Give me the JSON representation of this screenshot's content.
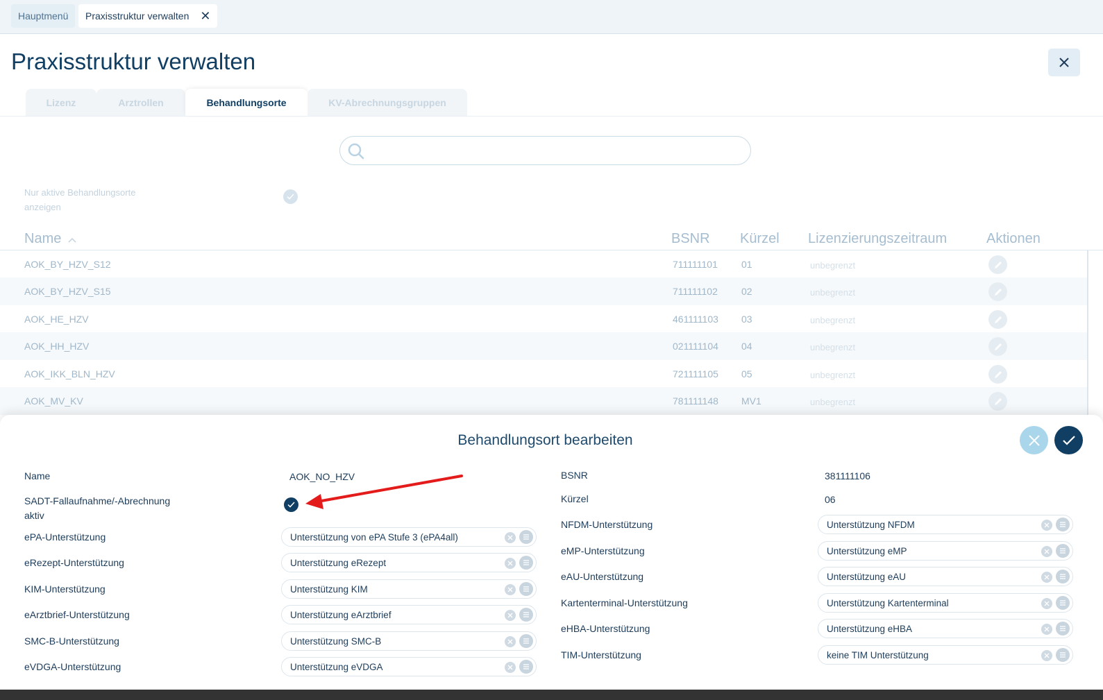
{
  "topbar": {
    "tab_home": "Hauptmenü",
    "tab_current": "Praxisstruktur verwalten",
    "tab_close": "✕"
  },
  "page": {
    "title": "Praxisstruktur verwalten"
  },
  "tabs": [
    {
      "label": "Lizenz",
      "active": false
    },
    {
      "label": "Arztrollen",
      "active": false
    },
    {
      "label": "Behandlungsorte",
      "active": true
    },
    {
      "label": "KV-Abrechnungsgruppen",
      "active": false
    }
  ],
  "search": {
    "placeholder": "",
    "value": ""
  },
  "filter": {
    "label": "Nur aktive Behandlungsorte anzeigen",
    "checked": true
  },
  "table": {
    "headers": {
      "name": "Name",
      "bsnr": "BSNR",
      "kuerzel": "Kürzel",
      "lizenz": "Lizenzierungszeitraum",
      "aktionen": "Aktionen"
    },
    "sort": "ascending",
    "rows": [
      {
        "name": "AOK_BY_HZV_S12",
        "bsnr": "711111101",
        "kuerzel": "01",
        "lizenz": "unbegrenzt"
      },
      {
        "name": "AOK_BY_HZV_S15",
        "bsnr": "711111102",
        "kuerzel": "02",
        "lizenz": "unbegrenzt"
      },
      {
        "name": "AOK_HE_HZV",
        "bsnr": "461111103",
        "kuerzel": "03",
        "lizenz": "unbegrenzt"
      },
      {
        "name": "AOK_HH_HZV",
        "bsnr": "021111104",
        "kuerzel": "04",
        "lizenz": "unbegrenzt"
      },
      {
        "name": "AOK_IKK_BLN_HZV",
        "bsnr": "721111105",
        "kuerzel": "05",
        "lizenz": "unbegrenzt"
      },
      {
        "name": "AOK_MV_KV",
        "bsnr": "781111148",
        "kuerzel": "MV1",
        "lizenz": "unbegrenzt"
      }
    ]
  },
  "editor": {
    "title": "Behandlungsort bearbeiten",
    "left": {
      "name_label": "Name",
      "name_value": "AOK_NO_HZV",
      "sadt_label": "SADT-Fallaufnahme/-Abrechnung aktiv",
      "sadt_checked": true,
      "selects": [
        {
          "label": "ePA-Unterstützung",
          "value": "Unterstützung von ePA Stufe 3 (ePA4all)"
        },
        {
          "label": "eRezept-Unterstützung",
          "value": "Unterstützung eRezept"
        },
        {
          "label": "KIM-Unterstützung",
          "value": "Unterstützung KIM"
        },
        {
          "label": "eArztbrief-Unterstützung",
          "value": "Unterstützung eArztbrief"
        },
        {
          "label": "SMC-B-Unterstützung",
          "value": "Unterstützung SMC-B"
        },
        {
          "label": "eVDGA-Unterstützung",
          "value": "Unterstützung eVDGA"
        }
      ]
    },
    "right": {
      "bsnr_label": "BSNR",
      "bsnr_value": "381111106",
      "kuerzel_label": "Kürzel",
      "kuerzel_value": "06",
      "selects": [
        {
          "label": "NFDM-Unterstützung",
          "value": "Unterstützung NFDM"
        },
        {
          "label": "eMP-Unterstützung",
          "value": "Unterstützung eMP"
        },
        {
          "label": "eAU-Unterstützung",
          "value": "Unterstützung eAU"
        },
        {
          "label": "Kartenterminal-Unterstützung",
          "value": "Unterstützung Kartenterminal"
        },
        {
          "label": "eHBA-Unterstützung",
          "value": "Unterstützung eHBA"
        },
        {
          "label": "TIM-Unterstützung",
          "value": "keine TIM Unterstützung"
        }
      ]
    }
  },
  "colors": {
    "primary": "#113f63",
    "accent_light": "#a9d6ea",
    "annotation_arrow": "#e41b1b"
  }
}
